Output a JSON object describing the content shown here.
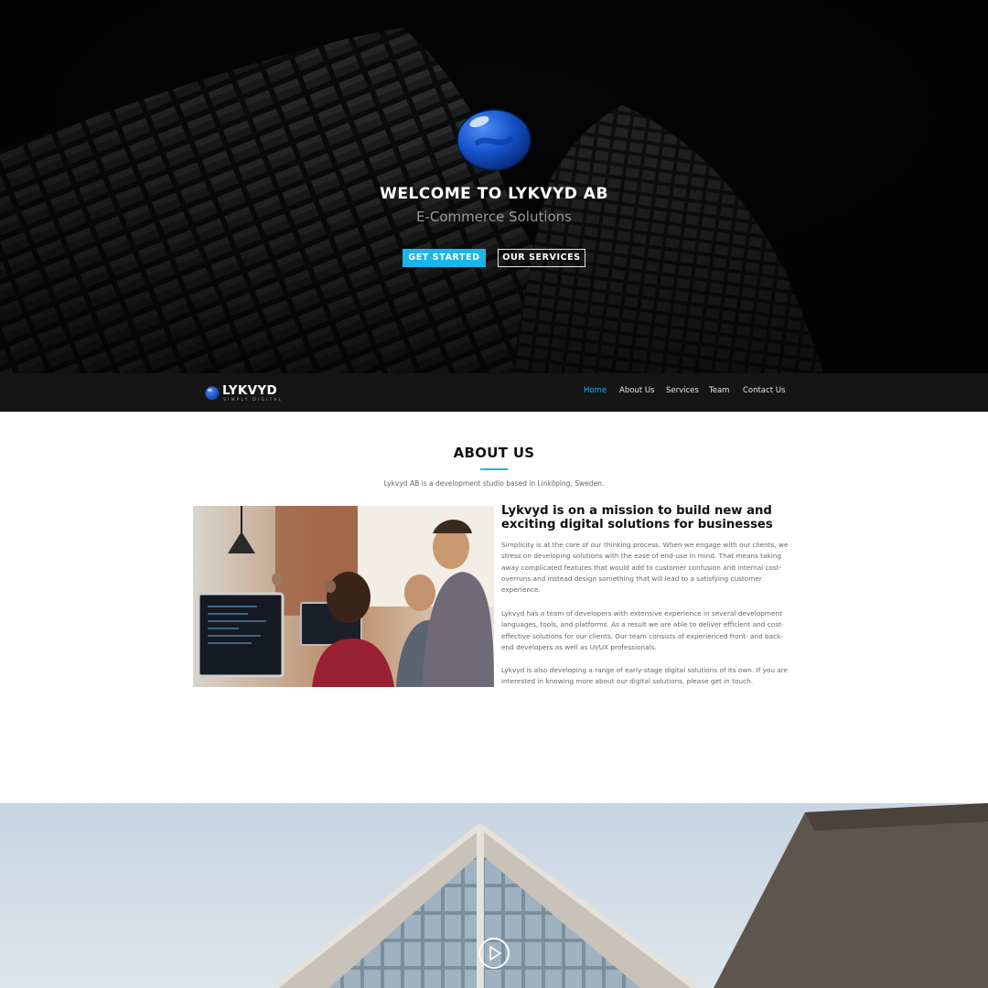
{
  "hero": {
    "title": "WELCOME TO LYKVYD AB",
    "subtitle": "E-Commerce Solutions",
    "primary_button": "GET STARTED",
    "secondary_button": "OUR SERVICES",
    "logo_icon": "blue-sphere-logo-icon"
  },
  "nav": {
    "brand_name": "LYKVYD",
    "brand_tagline": "SIMPLY DIGITAL",
    "items": [
      {
        "label": "Home",
        "active": true
      },
      {
        "label": "About Us",
        "active": false
      },
      {
        "label": "Services",
        "active": false
      },
      {
        "label": "Team",
        "active": false
      },
      {
        "label": "Contact Us",
        "active": false
      }
    ]
  },
  "about": {
    "title": "ABOUT US",
    "intro": "Lykvyd AB is a development studio based in Linköping, Sweden.",
    "headline": "Lykvyd is on a mission to build new and exciting digital solutions for businesses",
    "paragraphs": [
      "Simplicity is at the core of our thinking process. When we engage with our clients, we stress on developing solutions with the ease of end-use in mind. That means taking away complicated features that would add to customer confusion and internal cost-overruns and instead design something that will lead to a satisfying customer experience.",
      "Lykvyd has a team of developers with extensive experience in several development languages, tools, and platforms. As a result we are able to deliver efficient and cost-effective solutions for our clients. Our team consists of experienced front- and back-end developers as well as UI/UX professionals.",
      "Lykvyd is also developing a range of early-stage digital solutions of its own. If you are interested in knowing more about our digital solutions, please get in touch."
    ]
  },
  "bottom": {
    "play_icon": "play-circle-icon"
  },
  "colors": {
    "accent": "#19b6e9",
    "hero_bg": "#050505",
    "nav_bg": "#151515",
    "logo_blue": "#1553c9"
  }
}
